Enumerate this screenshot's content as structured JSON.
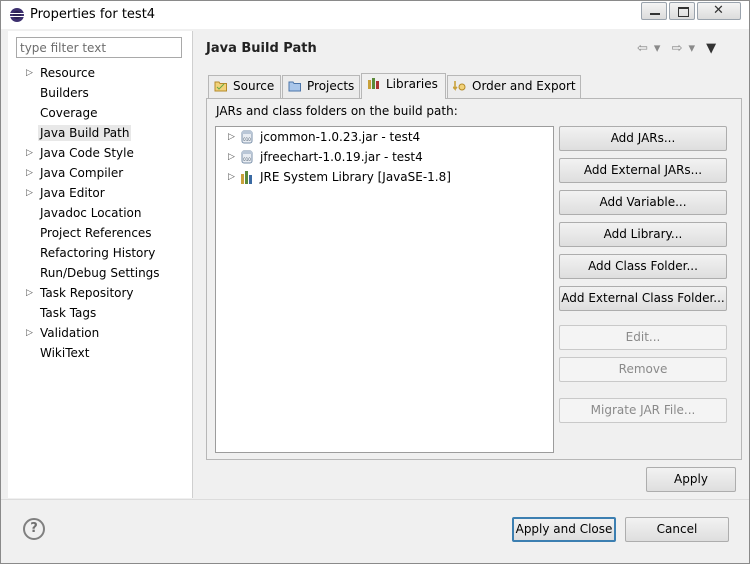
{
  "window": {
    "title": "Properties for test4"
  },
  "left": {
    "filter_placeholder": "type filter text",
    "items": [
      {
        "label": "Resource",
        "expandable": true
      },
      {
        "label": "Builders",
        "expandable": false
      },
      {
        "label": "Coverage",
        "expandable": false
      },
      {
        "label": "Java Build Path",
        "expandable": false,
        "selected": true
      },
      {
        "label": "Java Code Style",
        "expandable": true
      },
      {
        "label": "Java Compiler",
        "expandable": true
      },
      {
        "label": "Java Editor",
        "expandable": true
      },
      {
        "label": "Javadoc Location",
        "expandable": false
      },
      {
        "label": "Project References",
        "expandable": false
      },
      {
        "label": "Refactoring History",
        "expandable": false
      },
      {
        "label": "Run/Debug Settings",
        "expandable": false
      },
      {
        "label": "Task Repository",
        "expandable": true
      },
      {
        "label": "Task Tags",
        "expandable": false
      },
      {
        "label": "Validation",
        "expandable": true
      },
      {
        "label": "WikiText",
        "expandable": false
      }
    ]
  },
  "main": {
    "title": "Java Build Path",
    "tabs": [
      {
        "label": "Source",
        "icon": "source-folder-icon"
      },
      {
        "label": "Projects",
        "icon": "projects-folder-icon"
      },
      {
        "label": "Libraries",
        "icon": "libraries-icon",
        "active": true
      },
      {
        "label": "Order and Export",
        "icon": "order-export-icon"
      }
    ],
    "panel_label": "JARs and class folders on the build path:",
    "libraries": [
      {
        "label": "jcommon-1.0.23.jar - test4",
        "icon": "jar-icon"
      },
      {
        "label": "jfreechart-1.0.19.jar - test4",
        "icon": "jar-icon"
      },
      {
        "label": "JRE System Library [JavaSE-1.8]",
        "icon": "library-icon"
      }
    ],
    "buttons": [
      {
        "label": "Add JARs...",
        "enabled": true
      },
      {
        "label": "Add External JARs...",
        "enabled": true
      },
      {
        "label": "Add Variable...",
        "enabled": true
      },
      {
        "label": "Add Library...",
        "enabled": true
      },
      {
        "label": "Add Class Folder...",
        "enabled": true
      },
      {
        "label": "Add External Class Folder...",
        "enabled": true
      },
      {
        "label": "Edit...",
        "enabled": false
      },
      {
        "label": "Remove",
        "enabled": false
      },
      {
        "label": "Migrate JAR File...",
        "enabled": false
      }
    ],
    "apply_label": "Apply"
  },
  "footer": {
    "apply_close_label": "Apply and Close",
    "cancel_label": "Cancel"
  },
  "colors": {
    "accent": "#3c7fb1",
    "disabled_text": "#8a8a8a"
  }
}
